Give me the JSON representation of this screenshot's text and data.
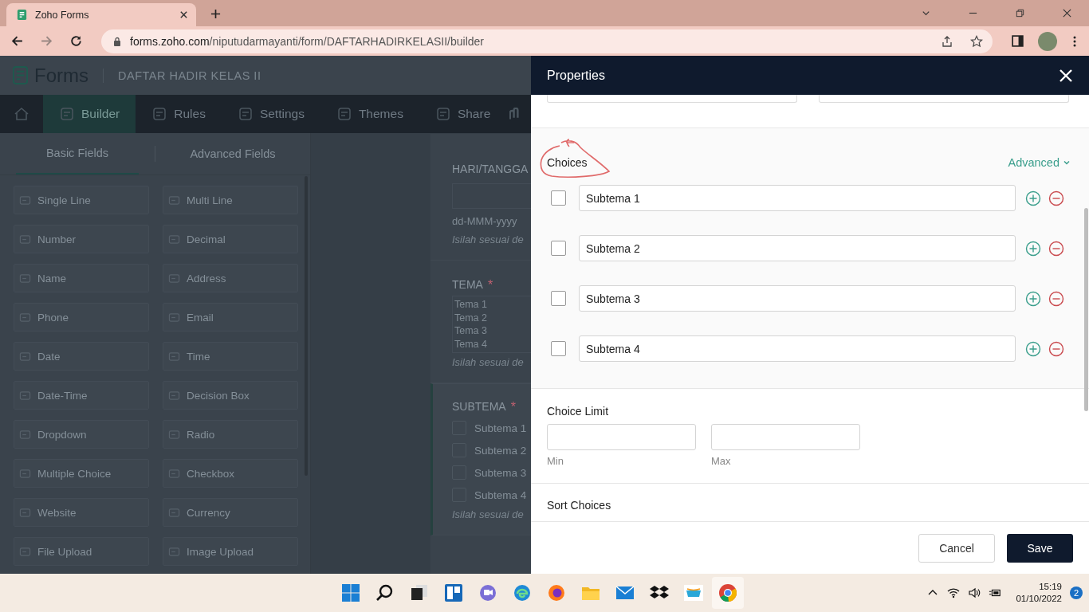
{
  "browser": {
    "tab_title": "Zoho Forms",
    "url_host": "forms.zoho.com",
    "url_path": "/niputudarmayanti/form/DAFTARHADIRKELASII/builder"
  },
  "app": {
    "logo_text": "Forms",
    "form_title": "DAFTAR HADIR KELAS II",
    "nav": [
      {
        "label": "Builder",
        "selected": true
      },
      {
        "label": "Rules",
        "selected": false
      },
      {
        "label": "Settings",
        "selected": false
      },
      {
        "label": "Themes",
        "selected": false
      },
      {
        "label": "Share",
        "selected": false
      }
    ]
  },
  "sidebar": {
    "tabs": [
      {
        "label": "Basic Fields",
        "selected": true
      },
      {
        "label": "Advanced Fields",
        "selected": false
      }
    ],
    "fields": [
      "Single Line",
      "Multi Line",
      "Number",
      "Decimal",
      "Name",
      "Address",
      "Phone",
      "Email",
      "Date",
      "Time",
      "Date-Time",
      "Decision Box",
      "Dropdown",
      "Radio",
      "Multiple Choice",
      "Checkbox",
      "Website",
      "Currency",
      "File Upload",
      "Image Upload"
    ]
  },
  "canvas": {
    "fields": [
      {
        "kind": "date",
        "label": "HARI/TANGGA",
        "selected": false,
        "format": "dd-MMM-yyyy",
        "hint": "Isilah sesuai de"
      },
      {
        "kind": "list",
        "label": "TEMA",
        "required_mark": "*",
        "selected": false,
        "options": [
          "Tema 1",
          "Tema 2",
          "Tema 3",
          "Tema 4"
        ],
        "hint": "Isilah sesuai de"
      },
      {
        "kind": "checkbox",
        "label": "SUBTEMA",
        "required_mark": "*",
        "selected": true,
        "options": [
          "Subtema 1",
          "Subtema 2",
          "Subtema 3",
          "Subtema 4"
        ],
        "hint": "Isilah sesuai de"
      }
    ]
  },
  "properties": {
    "title": "Properties",
    "choices_label": "Choices",
    "advanced_label": "Advanced",
    "choices": [
      {
        "value": "Subtema 1",
        "checked": false
      },
      {
        "value": "Subtema 2",
        "checked": false
      },
      {
        "value": "Subtema 3",
        "checked": false
      },
      {
        "value": "Subtema 4",
        "checked": false
      }
    ],
    "choice_limit_label": "Choice Limit",
    "min_label": "Min",
    "max_label": "Max",
    "sort_label": "Sort Choices",
    "cancel": "Cancel",
    "save": "Save"
  },
  "taskbar": {
    "time": "15:19",
    "date": "01/10/2022",
    "notifications": "2"
  }
}
